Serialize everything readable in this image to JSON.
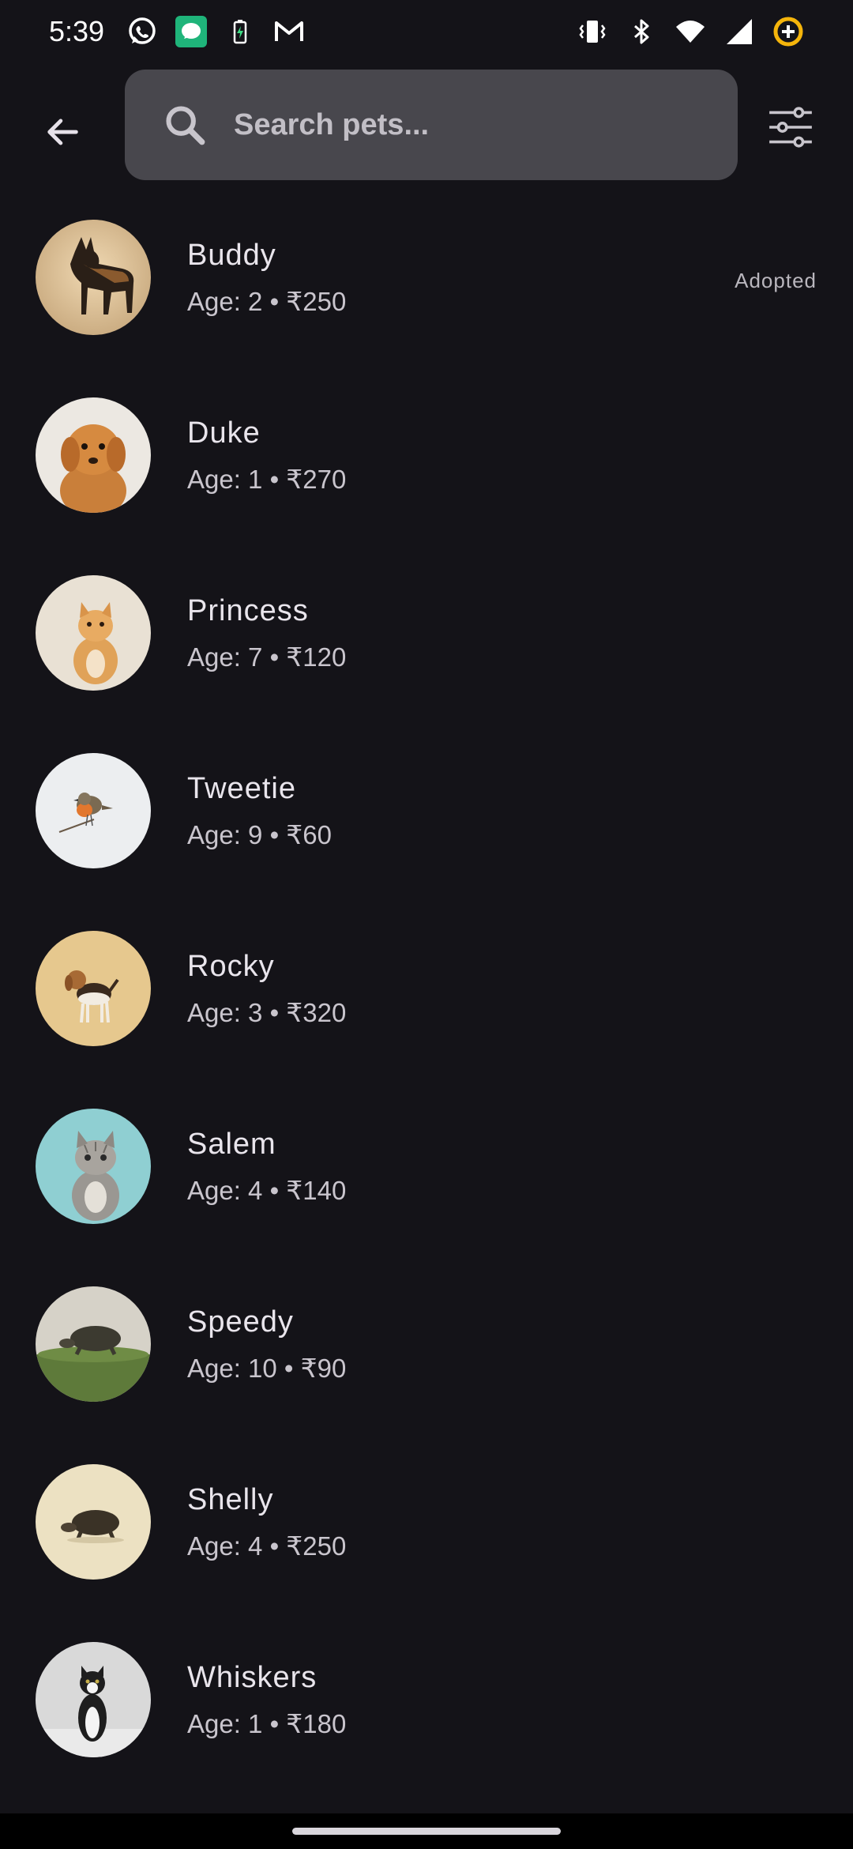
{
  "status_bar": {
    "time": "5:39",
    "left_icons": [
      "whatsapp-icon",
      "messages-icon",
      "battery-saver-icon",
      "gmail-icon"
    ],
    "right_icons": [
      "vibrate-icon",
      "bluetooth-icon",
      "wifi-icon",
      "signal-icon",
      "data-saver-icon"
    ],
    "accent_data_saver": "#f5b50b",
    "accent_messages": "#1fb47a"
  },
  "app_bar": {
    "back_icon": "arrow-back-icon",
    "search": {
      "placeholder": "Search pets...",
      "value": ""
    },
    "filter_icon": "tune-filter-icon"
  },
  "pets": [
    {
      "name": "Buddy",
      "meta": "Age: 2 • ₹250",
      "status": "Adopted",
      "image": "german-shepherd-photo"
    },
    {
      "name": "Duke",
      "meta": "Age: 1 • ₹270",
      "status": "",
      "image": "golden-puppy-photo"
    },
    {
      "name": "Princess",
      "meta": "Age: 7 • ₹120",
      "status": "",
      "image": "orange-kitten-photo"
    },
    {
      "name": "Tweetie",
      "meta": "Age: 9 • ₹60",
      "status": "",
      "image": "robin-bird-photo"
    },
    {
      "name": "Rocky",
      "meta": "Age: 3 • ₹320",
      "status": "",
      "image": "beagle-photo"
    },
    {
      "name": "Salem",
      "meta": "Age: 4 • ₹140",
      "status": "",
      "image": "grey-tabby-kitten-photo"
    },
    {
      "name": "Speedy",
      "meta": "Age: 10 • ₹90",
      "status": "",
      "image": "turtle-on-grass-photo"
    },
    {
      "name": "Shelly",
      "meta": "Age: 4 • ₹250",
      "status": "",
      "image": "tortoise-photo"
    },
    {
      "name": "Whiskers",
      "meta": "Age: 1 • ₹180",
      "status": "",
      "image": "tuxedo-cat-photo"
    }
  ],
  "colors": {
    "background": "#141318",
    "search_fill": "#48474d",
    "text_primary": "#e9e5ec",
    "text_secondary": "#c9c5cd"
  }
}
